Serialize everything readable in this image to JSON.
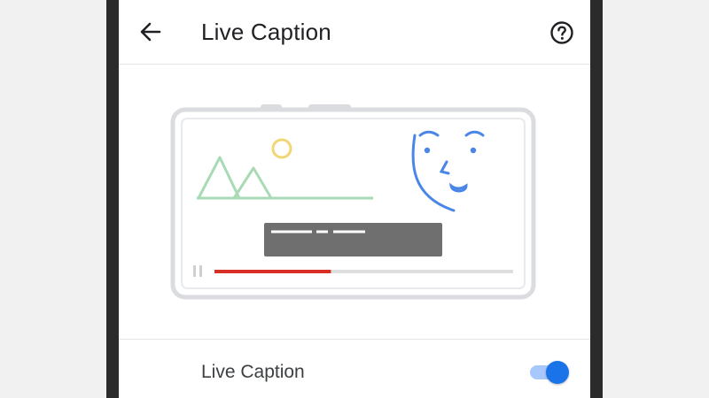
{
  "app_bar": {
    "title": "Live Caption",
    "back_icon": "arrow-back-icon",
    "help_icon": "help-circle-icon"
  },
  "settings": {
    "live_caption_label": "Live Caption",
    "live_caption_enabled": true
  },
  "colors": {
    "accent": "#1a73e8",
    "progress_played": "#d93025",
    "mountains": "#a8dab5",
    "sun": "#f2d675",
    "face": "#4a86e8",
    "caption_box": "#6f6f6f"
  },
  "video": {
    "progress": 0.39
  }
}
